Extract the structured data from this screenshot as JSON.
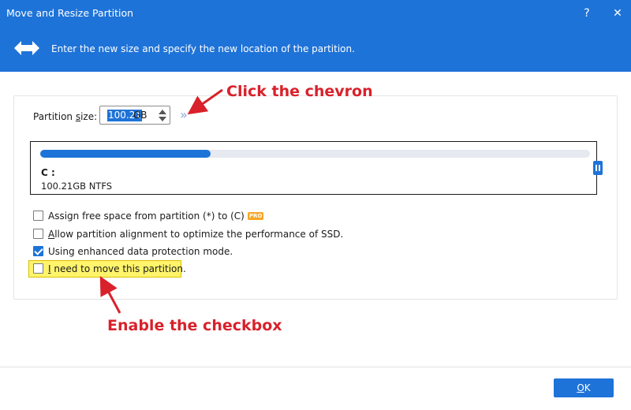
{
  "window": {
    "title": "Move and Resize Partition",
    "help_glyph": "?",
    "close_glyph": "✕"
  },
  "banner": {
    "text": "Enter the new size and specify the new location of the partition.",
    "icon": "resize-arrows-icon"
  },
  "partition_size": {
    "label_prefix": "Partition ",
    "label_mnemonic": "s",
    "label_suffix": "ize:",
    "value": "100.21",
    "unit": "GB",
    "chevron": "»"
  },
  "partition": {
    "letter": "C :",
    "info": "100.21GB NTFS",
    "used_fraction": 0.31,
    "bar_color": "#1e73d8"
  },
  "options": [
    {
      "label": "Assign free space from partition (*) to (C)",
      "checked": false,
      "pro_badge": "PRO"
    },
    {
      "label_mnemonic": "A",
      "label": "llow partition alignment to optimize the performance of SSD.",
      "checked": false
    },
    {
      "label": "Using enhanced data protection mode.",
      "checked": true
    },
    {
      "label_mnemonic": "I",
      "label": " need to move this partition.",
      "checked": false
    }
  ],
  "annotations": {
    "chevron_note": "Click the chevron",
    "checkbox_note": "Enable the checkbox"
  },
  "footer": {
    "ok_label_mnemonic": "O",
    "ok_label_rest": "K"
  },
  "colors": {
    "accent": "#1e73d8",
    "annotation": "#d9212b",
    "highlight": "#fff46b"
  }
}
